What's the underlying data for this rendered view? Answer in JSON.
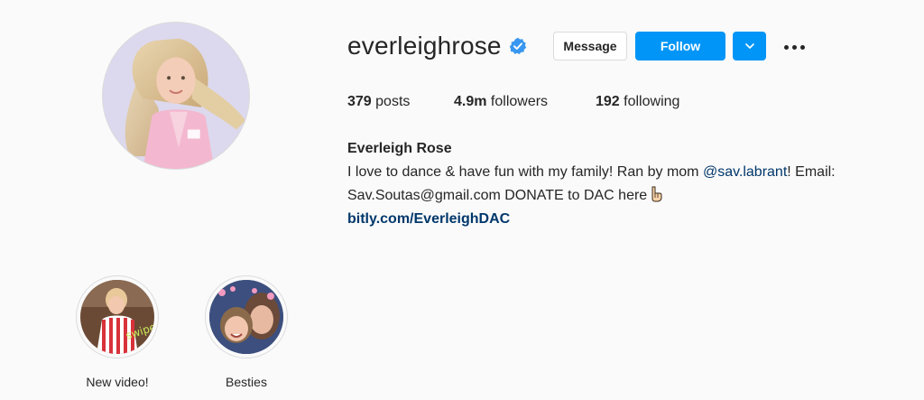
{
  "profile": {
    "username": "everleighrose",
    "verified": true,
    "full_name": "Everleigh Rose",
    "avatar_icon": "profile-photo"
  },
  "actions": {
    "message_label": "Message",
    "follow_label": "Follow",
    "dropdown_icon": "chevron-down-icon",
    "more_icon": "more-options-icon"
  },
  "stats": {
    "posts_count": "379",
    "posts_label": "posts",
    "followers_count": "4.9m",
    "followers_label": "followers",
    "following_count": "192",
    "following_label": "following"
  },
  "bio": {
    "line1_text": "I love to dance & have fun with my family! Ran by mom ",
    "mention": "@sav.labrant",
    "line1_tail": "! Email:",
    "line2_text": "Sav.Soutas@gmail.com DONATE to DAC here",
    "line2_emoji": "pointing-down-icon",
    "link": "bitly.com/EverleighDAC"
  },
  "highlights": [
    {
      "label": "New video!"
    },
    {
      "label": "Besties"
    }
  ],
  "colors": {
    "background": "#fafafa",
    "accent": "#0095f6",
    "text": "#262626",
    "link": "#00376b",
    "border": "#dbdbdb"
  }
}
